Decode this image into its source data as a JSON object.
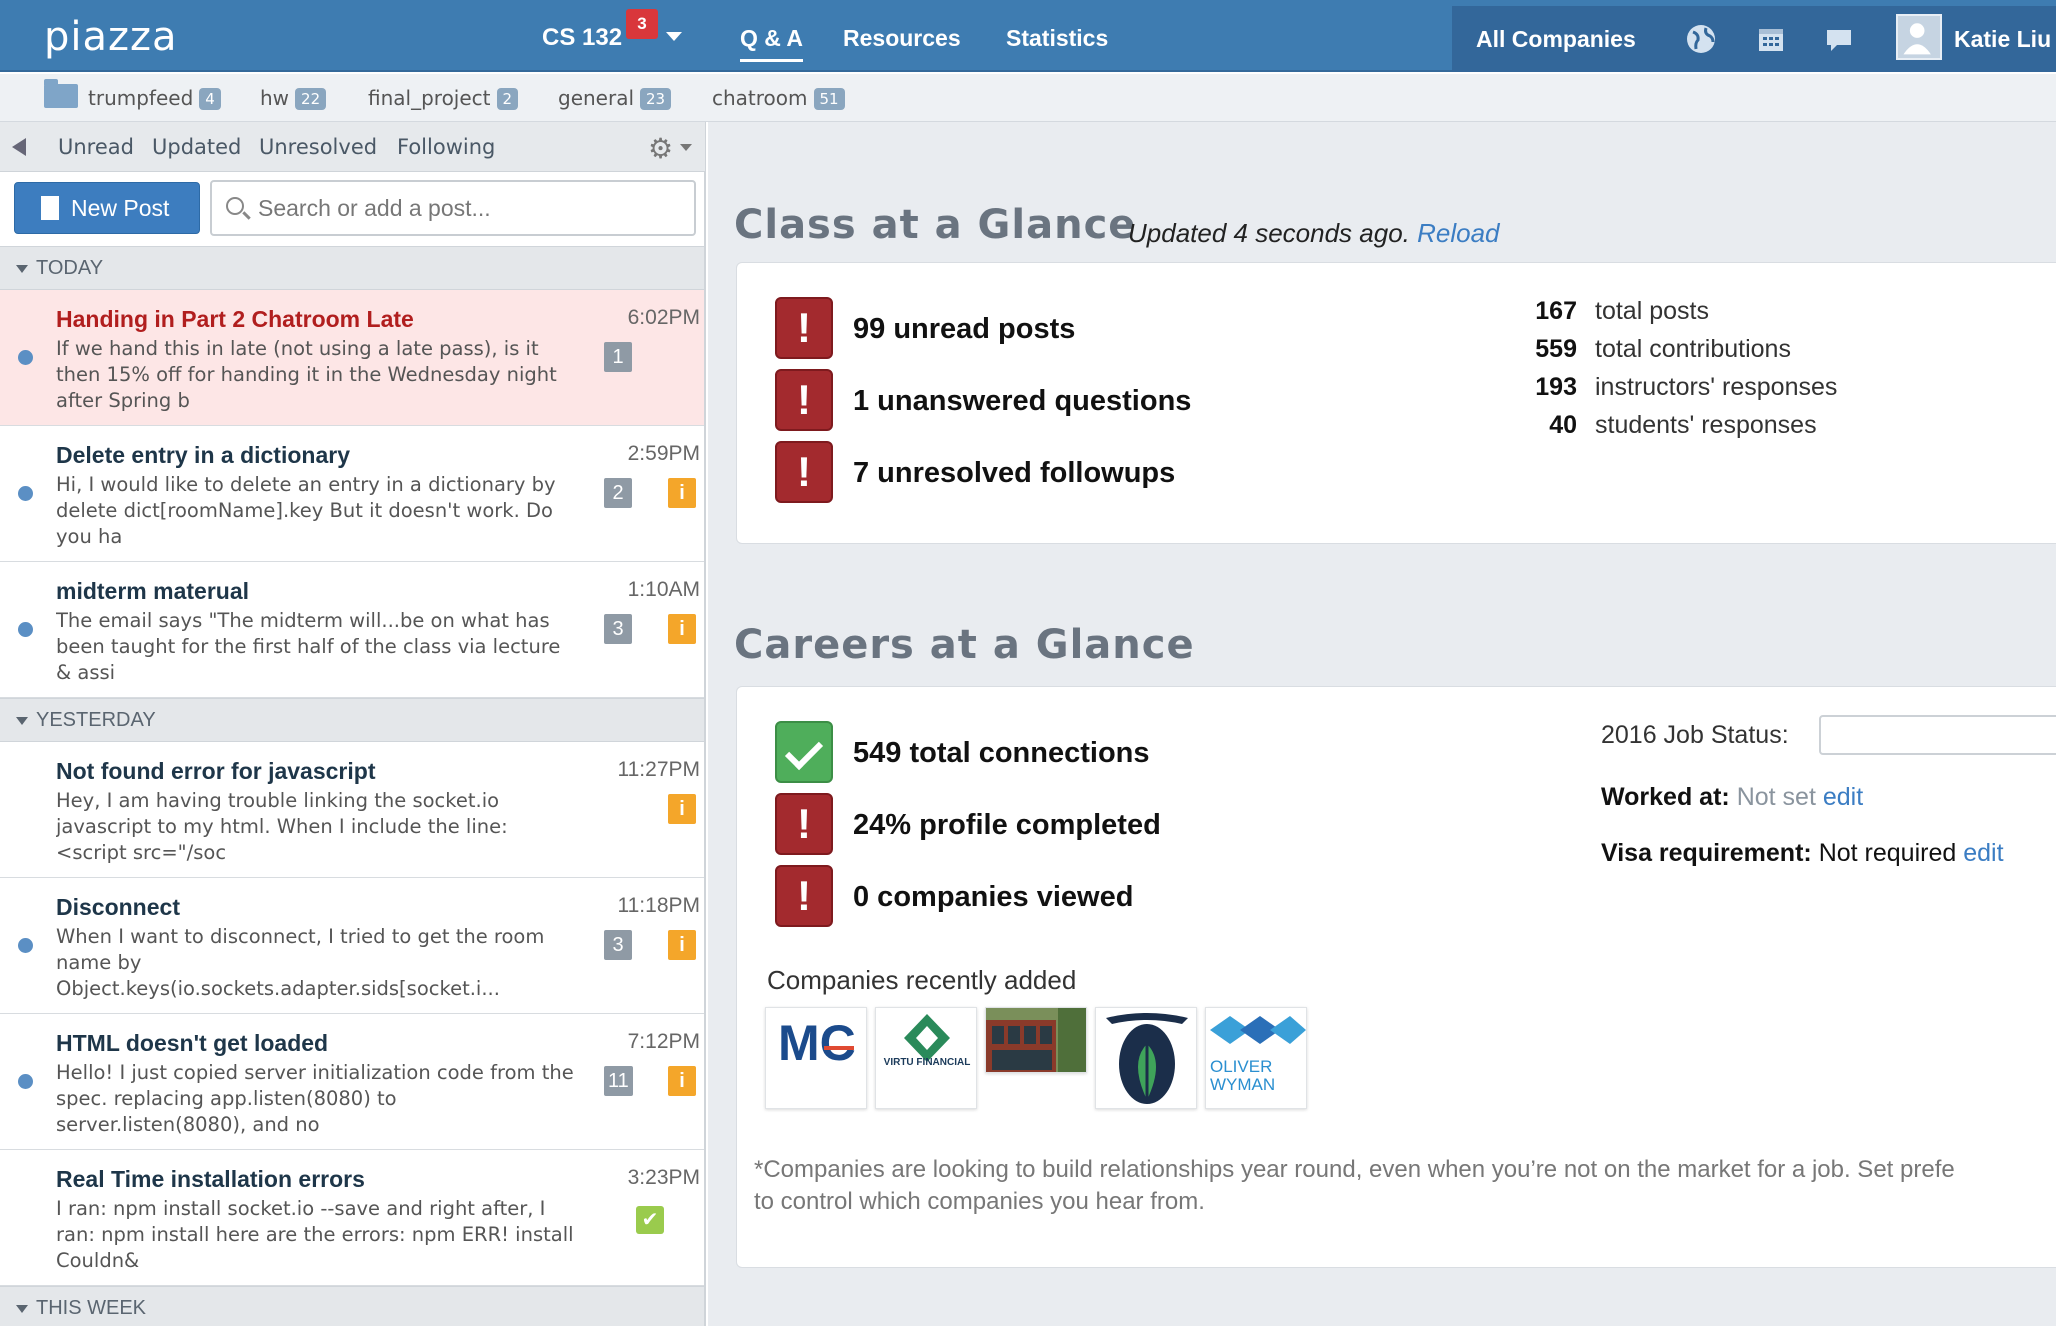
{
  "app": {
    "logo": "piazza",
    "course": "CS 132",
    "course_badge": "3"
  },
  "nav": {
    "qa": "Q & A",
    "resources": "Resources",
    "statistics": "Statistics"
  },
  "top_right": {
    "companies": "All Companies",
    "user": "Katie Liu"
  },
  "folders": [
    {
      "name": "trumpfeed",
      "count": "4"
    },
    {
      "name": "hw",
      "count": "22"
    },
    {
      "name": "final_project",
      "count": "2"
    },
    {
      "name": "general",
      "count": "23"
    },
    {
      "name": "chatroom",
      "count": "51"
    }
  ],
  "filters": [
    "Unread",
    "Updated",
    "Unresolved",
    "Following"
  ],
  "new_post": "New Post",
  "search_placeholder": "Search or add a post...",
  "groups": {
    "today": "TODAY",
    "yesterday": "YESTERDAY",
    "this_week": "THIS WEEK"
  },
  "posts": [
    {
      "title": "Handing in Part 2 Chatroom Late",
      "snippet": "If we hand this in late (not using a late pass), is it then 15% off for handing it in the Wednesday night after Spring b",
      "time": "6:02PM",
      "count": "1"
    },
    {
      "title": "Delete entry in a dictionary",
      "snippet": "Hi, I would like to delete an entry in a dictionary by delete dict[roomName].key  But it doesn't work. Do you ha",
      "time": "2:59PM",
      "count": "2",
      "info": "i"
    },
    {
      "title": "midterm materual",
      "snippet": "The email says \"The midterm will...be on what has been taught for the first half of the class via lecture & assi",
      "time": "1:10AM",
      "count": "3",
      "info": "i"
    },
    {
      "title": "Not found error for javascript",
      "snippet": "Hey, I am having trouble linking the socket.io javascript to my html. When I include the line: <script src=\"/soc",
      "time": "11:27PM",
      "info": "i"
    },
    {
      "title": "Disconnect",
      "snippet": "When I want to disconnect, I tried to get the room name by Object.keys(io.sockets.adapter.sids[socket.i...",
      "time": "11:18PM",
      "count": "3",
      "info": "i"
    },
    {
      "title": "HTML doesn't get loaded",
      "snippet": "Hello! I just copied server initialization code from the spec. replacing app.listen(8080) to server.listen(8080), and no",
      "time": "7:12PM",
      "count": "11",
      "info": "i"
    },
    {
      "title": "Real Time installation errors",
      "snippet": "I ran: npm install socket.io --save and right after, I ran: npm install here are the errors: npm ERR! install Couldn&",
      "time": "3:23PM"
    }
  ],
  "class_glance": {
    "title": "Class at a Glance",
    "updated_prefix": "Updated   4 seconds ago.",
    "reload": "Reload",
    "stats": [
      "99 unread posts",
      "1 unanswered questions",
      "7 unresolved followups"
    ],
    "totals": [
      {
        "num": "167",
        "label": "total posts"
      },
      {
        "num": "559",
        "label": "total contributions"
      },
      {
        "num": "193",
        "label": "instructors' responses"
      },
      {
        "num": "40",
        "label": "students' responses"
      }
    ]
  },
  "careers_glance": {
    "title": "Careers at a Glance",
    "stats": [
      "549 total connections",
      "24% profile completed",
      "0 companies viewed"
    ],
    "job_status_label": "2016 Job Status:",
    "worked_at_label": "Worked at:",
    "worked_at_value": "Not set",
    "visa_label": "Visa requirement:",
    "visa_value": "Not required",
    "edit": "edit",
    "companies_heading": "Companies recently added",
    "logos": {
      "mc": "MC",
      "virtu": "VIRTU FINANCIAL",
      "oliver1": "OLIVER",
      "oliver2": "WYMAN"
    },
    "footnote_1": "*Companies are looking to build relationships year round, even when you’re not on the market for a job. Set prefe",
    "footnote_2": "to control which companies you hear from."
  },
  "colors": {
    "topbar": "#3e7cb1",
    "alert": "#a32a2e",
    "success": "#4fae5b",
    "info": "#f4a62a",
    "link": "#3b7dc3"
  }
}
